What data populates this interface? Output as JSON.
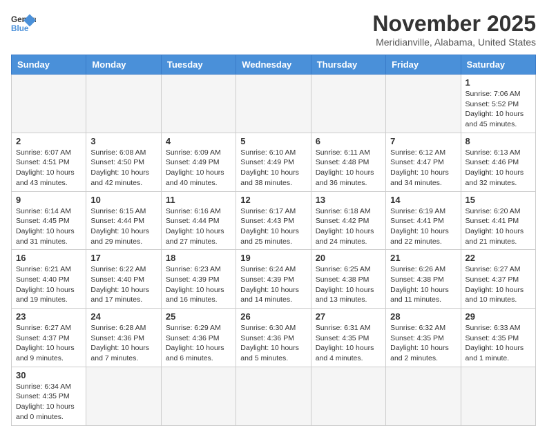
{
  "header": {
    "logo_general": "General",
    "logo_blue": "Blue",
    "month": "November 2025",
    "location": "Meridianville, Alabama, United States"
  },
  "weekdays": [
    "Sunday",
    "Monday",
    "Tuesday",
    "Wednesday",
    "Thursday",
    "Friday",
    "Saturday"
  ],
  "weeks": [
    [
      {
        "day": "",
        "info": ""
      },
      {
        "day": "",
        "info": ""
      },
      {
        "day": "",
        "info": ""
      },
      {
        "day": "",
        "info": ""
      },
      {
        "day": "",
        "info": ""
      },
      {
        "day": "",
        "info": ""
      },
      {
        "day": "1",
        "info": "Sunrise: 7:06 AM\nSunset: 5:52 PM\nDaylight: 10 hours and 45 minutes."
      }
    ],
    [
      {
        "day": "2",
        "info": "Sunrise: 6:07 AM\nSunset: 4:51 PM\nDaylight: 10 hours and 43 minutes."
      },
      {
        "day": "3",
        "info": "Sunrise: 6:08 AM\nSunset: 4:50 PM\nDaylight: 10 hours and 42 minutes."
      },
      {
        "day": "4",
        "info": "Sunrise: 6:09 AM\nSunset: 4:49 PM\nDaylight: 10 hours and 40 minutes."
      },
      {
        "day": "5",
        "info": "Sunrise: 6:10 AM\nSunset: 4:49 PM\nDaylight: 10 hours and 38 minutes."
      },
      {
        "day": "6",
        "info": "Sunrise: 6:11 AM\nSunset: 4:48 PM\nDaylight: 10 hours and 36 minutes."
      },
      {
        "day": "7",
        "info": "Sunrise: 6:12 AM\nSunset: 4:47 PM\nDaylight: 10 hours and 34 minutes."
      },
      {
        "day": "8",
        "info": "Sunrise: 6:13 AM\nSunset: 4:46 PM\nDaylight: 10 hours and 32 minutes."
      }
    ],
    [
      {
        "day": "9",
        "info": "Sunrise: 6:14 AM\nSunset: 4:45 PM\nDaylight: 10 hours and 31 minutes."
      },
      {
        "day": "10",
        "info": "Sunrise: 6:15 AM\nSunset: 4:44 PM\nDaylight: 10 hours and 29 minutes."
      },
      {
        "day": "11",
        "info": "Sunrise: 6:16 AM\nSunset: 4:44 PM\nDaylight: 10 hours and 27 minutes."
      },
      {
        "day": "12",
        "info": "Sunrise: 6:17 AM\nSunset: 4:43 PM\nDaylight: 10 hours and 25 minutes."
      },
      {
        "day": "13",
        "info": "Sunrise: 6:18 AM\nSunset: 4:42 PM\nDaylight: 10 hours and 24 minutes."
      },
      {
        "day": "14",
        "info": "Sunrise: 6:19 AM\nSunset: 4:41 PM\nDaylight: 10 hours and 22 minutes."
      },
      {
        "day": "15",
        "info": "Sunrise: 6:20 AM\nSunset: 4:41 PM\nDaylight: 10 hours and 21 minutes."
      }
    ],
    [
      {
        "day": "16",
        "info": "Sunrise: 6:21 AM\nSunset: 4:40 PM\nDaylight: 10 hours and 19 minutes."
      },
      {
        "day": "17",
        "info": "Sunrise: 6:22 AM\nSunset: 4:40 PM\nDaylight: 10 hours and 17 minutes."
      },
      {
        "day": "18",
        "info": "Sunrise: 6:23 AM\nSunset: 4:39 PM\nDaylight: 10 hours and 16 minutes."
      },
      {
        "day": "19",
        "info": "Sunrise: 6:24 AM\nSunset: 4:39 PM\nDaylight: 10 hours and 14 minutes."
      },
      {
        "day": "20",
        "info": "Sunrise: 6:25 AM\nSunset: 4:38 PM\nDaylight: 10 hours and 13 minutes."
      },
      {
        "day": "21",
        "info": "Sunrise: 6:26 AM\nSunset: 4:38 PM\nDaylight: 10 hours and 11 minutes."
      },
      {
        "day": "22",
        "info": "Sunrise: 6:27 AM\nSunset: 4:37 PM\nDaylight: 10 hours and 10 minutes."
      }
    ],
    [
      {
        "day": "23",
        "info": "Sunrise: 6:27 AM\nSunset: 4:37 PM\nDaylight: 10 hours and 9 minutes."
      },
      {
        "day": "24",
        "info": "Sunrise: 6:28 AM\nSunset: 4:36 PM\nDaylight: 10 hours and 7 minutes."
      },
      {
        "day": "25",
        "info": "Sunrise: 6:29 AM\nSunset: 4:36 PM\nDaylight: 10 hours and 6 minutes."
      },
      {
        "day": "26",
        "info": "Sunrise: 6:30 AM\nSunset: 4:36 PM\nDaylight: 10 hours and 5 minutes."
      },
      {
        "day": "27",
        "info": "Sunrise: 6:31 AM\nSunset: 4:35 PM\nDaylight: 10 hours and 4 minutes."
      },
      {
        "day": "28",
        "info": "Sunrise: 6:32 AM\nSunset: 4:35 PM\nDaylight: 10 hours and 2 minutes."
      },
      {
        "day": "29",
        "info": "Sunrise: 6:33 AM\nSunset: 4:35 PM\nDaylight: 10 hours and 1 minute."
      }
    ],
    [
      {
        "day": "30",
        "info": "Sunrise: 6:34 AM\nSunset: 4:35 PM\nDaylight: 10 hours and 0 minutes."
      },
      {
        "day": "",
        "info": ""
      },
      {
        "day": "",
        "info": ""
      },
      {
        "day": "",
        "info": ""
      },
      {
        "day": "",
        "info": ""
      },
      {
        "day": "",
        "info": ""
      },
      {
        "day": "",
        "info": ""
      }
    ]
  ]
}
